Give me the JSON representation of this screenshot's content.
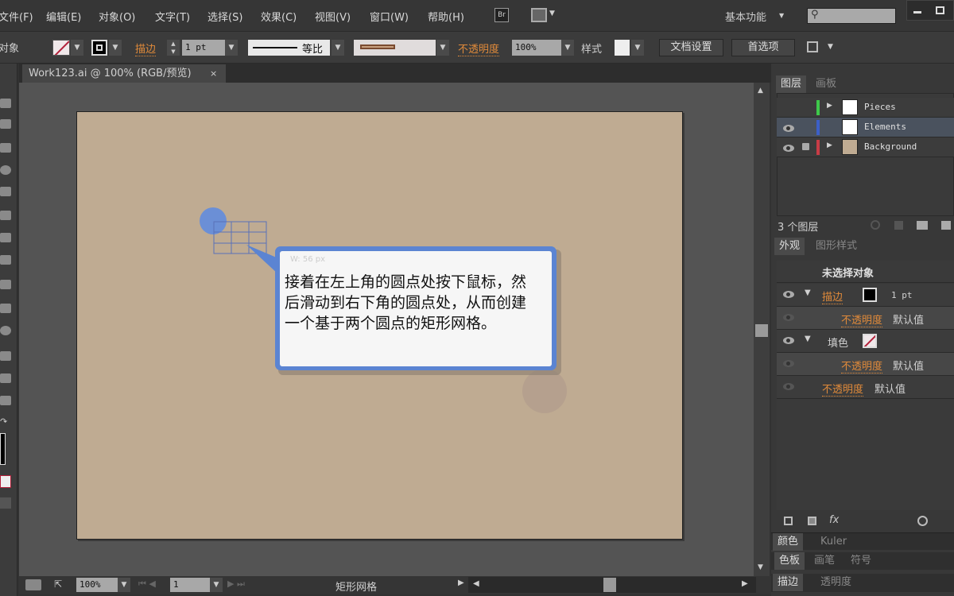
{
  "menu": [
    "文件(F)",
    "编辑(E)",
    "对象(O)",
    "文字(T)",
    "选择(S)",
    "效果(C)",
    "视图(V)",
    "窗口(W)",
    "帮助(H)"
  ],
  "topbar": {
    "bridge": "Br",
    "workspace": "基本功能"
  },
  "control": {
    "selection_label": "对象",
    "stroke_label": "描边",
    "stroke_weight": "1 pt",
    "profile_label": "等比",
    "opacity_label": "不透明度",
    "opacity_value": "100%",
    "style_label": "样式",
    "doc_setup": "文档设置",
    "preferences": "首选项"
  },
  "document_tab": {
    "title": "Work123.ai @ 100% (RGB/预览)",
    "close": "×"
  },
  "canvas": {
    "artboard_color": "#bfab92",
    "accent": "#5b84d2",
    "tooltip_hint": "W: 56 px",
    "callout_text": "接着在左上角的圆点处按下鼠标，然后滑动到右下角的圆点处，从而创建一个基于两个圆点的矩形网格。"
  },
  "status": {
    "zoom": "100%",
    "artboard": "1",
    "tool_name": "矩形网格"
  },
  "layers_panel": {
    "tabs": [
      "图层",
      "画板"
    ],
    "layers": [
      {
        "name": "Pieces",
        "color": "#3ec94a",
        "visible": false,
        "locked": false
      },
      {
        "name": "Elements",
        "color": "#3c5fc8",
        "visible": true,
        "locked": false,
        "selected": true
      },
      {
        "name": "Background",
        "color": "#c83c46",
        "visible": true,
        "locked": true
      }
    ],
    "count": "3 个图层"
  },
  "appearance_panel": {
    "tabs": [
      "外观",
      "图形样式"
    ],
    "header": "未选择对象",
    "stroke_label": "描边",
    "stroke_value": "1 pt",
    "opacity_label": "不透明度",
    "default_value": "默认值",
    "fill_label": "填色",
    "fx": "fx"
  },
  "collapsed_panels": [
    {
      "tabs": [
        "颜色",
        "Kuler"
      ]
    },
    {
      "tabs": [
        "色板",
        "画笔",
        "符号"
      ]
    },
    {
      "tabs": [
        "描边",
        "透明度"
      ]
    }
  ]
}
